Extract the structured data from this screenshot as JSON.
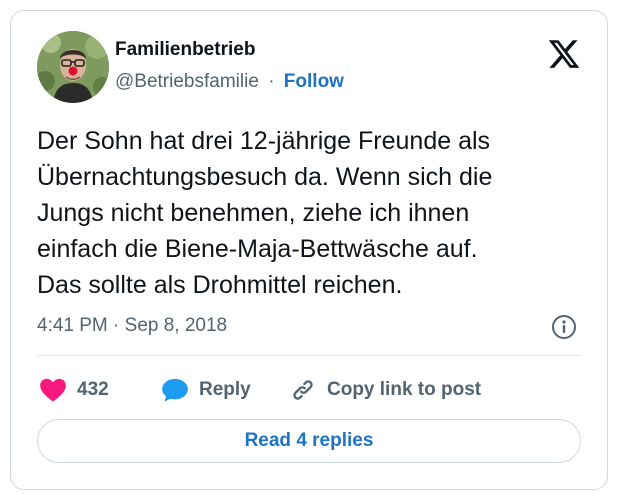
{
  "author": {
    "display_name": "Familienbetrieb",
    "handle": "@Betriebsfamilie",
    "separator": "·",
    "follow_label": "Follow"
  },
  "tweet": {
    "lines": [
      "Der Sohn hat drei 12-jährige Freunde als",
      "Übernachtungsbesuch da. Wenn sich die",
      "Jungs nicht benehmen, ziehe ich ihnen",
      "einfach die Biene-Maja-Bettwäsche auf.",
      "Das sollte als Drohmittel reichen."
    ],
    "timestamp": "4:41 PM · Sep 8, 2018"
  },
  "actions": {
    "like_count": "432",
    "reply_label": "Reply",
    "copy_label": "Copy link to post"
  },
  "footer": {
    "read_replies_label": "Read 4 replies"
  },
  "icons": {
    "brand": "x-logo-icon",
    "info": "info-icon",
    "like": "heart-icon",
    "reply": "speech-bubble-icon",
    "copy": "link-icon"
  },
  "colors": {
    "link": "#1d74c4",
    "heart": "#f91880",
    "reply_bubble": "#1d9bf0",
    "muted": "#536471"
  }
}
